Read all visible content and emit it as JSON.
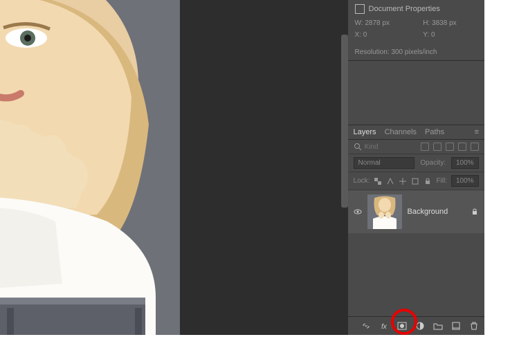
{
  "properties": {
    "title": "Document Properties",
    "width_label": "W:",
    "width_value": "2878 px",
    "height_label": "H:",
    "height_value": "3838 px",
    "x_label": "X:",
    "x_value": "0",
    "y_label": "Y:",
    "y_value": "0",
    "resolution": "Resolution: 300 pixels/inch"
  },
  "layers": {
    "tabs": {
      "layers": "Layers",
      "channels": "Channels",
      "paths": "Paths"
    },
    "filter_placeholder": "Kind",
    "blend_mode": "Normal",
    "opacity_label": "Opacity:",
    "opacity_value": "100%",
    "lock_label": "Lock:",
    "fill_label": "Fill:",
    "fill_value": "100%",
    "layer": {
      "name": "Background"
    }
  }
}
